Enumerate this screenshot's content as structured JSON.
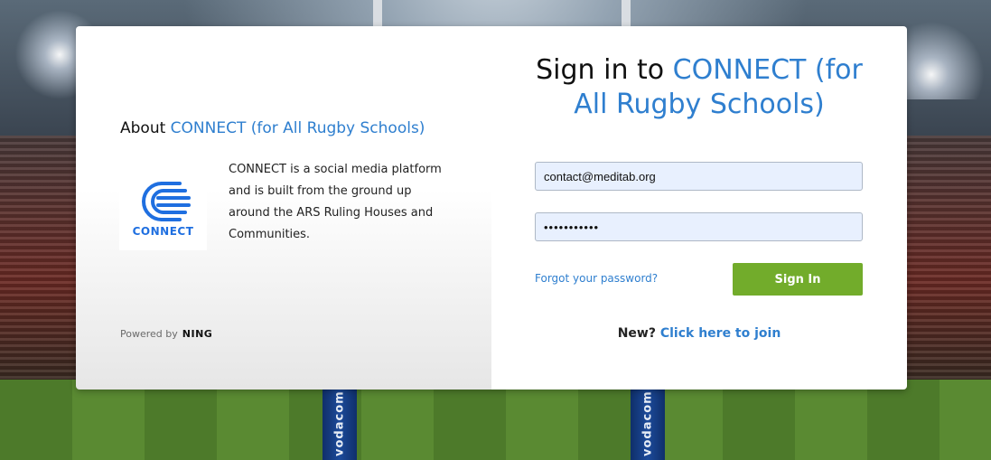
{
  "background": {
    "pad_text": "vodacom"
  },
  "about": {
    "prefix": "About",
    "site_name": "CONNECT (for All Rugby Schools)",
    "logo_word": "CONNECT",
    "description": "CONNECT is a social media platform and is built from the ground up around the ARS Ruling Houses and Communities.",
    "powered_by_label": "Powered by",
    "powered_by_brand": "NING"
  },
  "signin": {
    "title_prefix": "Sign in to",
    "site_name": "CONNECT (for All Rugby Schools)",
    "email_value": "contact@meditab.org",
    "password_value": "•••••••••••",
    "forgot_label": "Forgot your password?",
    "button_label": "Sign In",
    "new_label": "New?",
    "join_label": "Click here to join"
  },
  "colors": {
    "accent": "#2f7fcf",
    "button": "#72ac2b",
    "input_bg": "#e8f0fe"
  },
  "icons": {
    "logo": "connect-logo-icon"
  }
}
